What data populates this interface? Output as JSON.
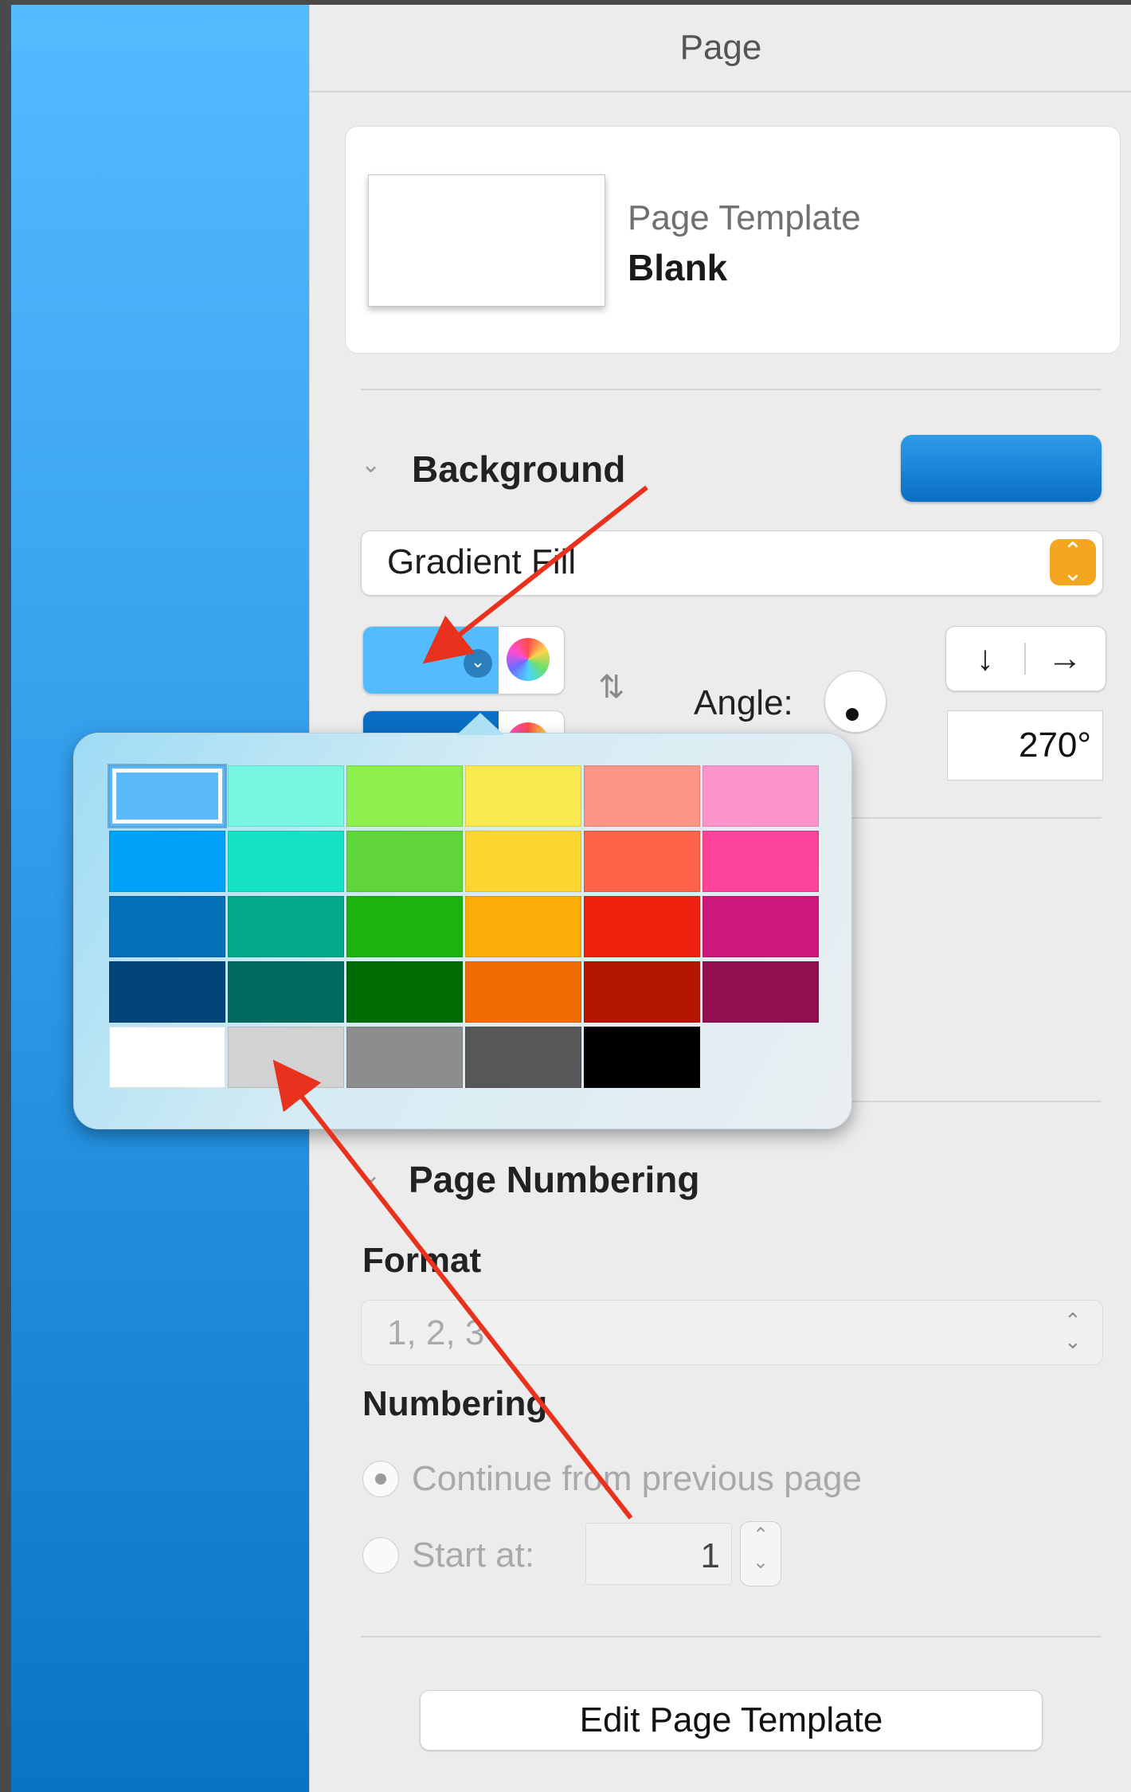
{
  "header": {
    "title": "Page"
  },
  "template": {
    "label": "Page Template",
    "value": "Blank"
  },
  "background": {
    "title": "Background",
    "fill_type": "Gradient Fill",
    "angle_label": "Angle:",
    "angle_value": "270°",
    "direction_down_icon": "↓",
    "direction_right_icon": "→",
    "start_color": "#55bbff",
    "end_color": "#0a6fc4"
  },
  "palette": {
    "rows": [
      [
        "#5ab9f8",
        "#77f7e2",
        "#8ef04d",
        "#fbe951",
        "#fb9585",
        "#fc95cb"
      ],
      [
        "#00a1f9",
        "#15e3c7",
        "#5fd53a",
        "#fcd531",
        "#fc6349",
        "#fc4399"
      ],
      [
        "#046eb7",
        "#02a889",
        "#1bb30e",
        "#fbac06",
        "#ee210e",
        "#cc177b"
      ],
      [
        "#03447a",
        "#016b60",
        "#006d04",
        "#f16c05",
        "#b51602",
        "#930d51"
      ],
      [
        "#ffffff",
        "#d2d2d2",
        "#8d8d8d",
        "#575757",
        "#000000"
      ]
    ],
    "selected": "#5ab9f8"
  },
  "numbering": {
    "title": "Page Numbering",
    "format_label": "Format",
    "format_value": "1, 2, 3",
    "numbering_label": "Numbering",
    "option_continue": "Continue from previous page",
    "option_start": "Start at:",
    "start_value": "1"
  },
  "footer": {
    "edit_button": "Edit Page Template"
  }
}
